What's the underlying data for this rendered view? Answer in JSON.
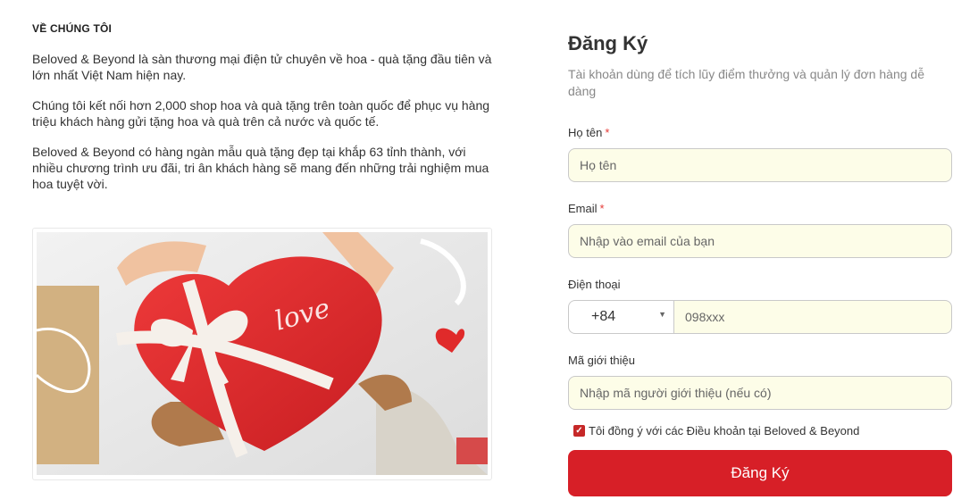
{
  "about": {
    "heading": "VỀ CHÚNG TÔI",
    "paragraphs": [
      "Beloved & Beyond là sàn thương mại điện tử chuyên về hoa - quà tặng đầu tiên và lớn nhất Việt Nam hiện nay.",
      "Chúng tôi kết nối hơn 2,000 shop hoa và quà tặng trên toàn quốc để phục vụ hàng triệu khách hàng gửi tặng hoa và quà trên cả nước và quốc tế.",
      "Beloved & Beyond có hàng ngàn mẫu quà tặng đẹp tại khắp 63 tỉnh thành, với nhiều chương trình ưu đãi, tri ân khách hàng sẽ mang đến những trải nghiệm mua hoa tuyệt vời."
    ],
    "photo_caption_text": "love"
  },
  "signup": {
    "title": "Đăng Ký",
    "subtitle": "Tài khoản dùng để tích lũy điểm thưởng và quản lý đơn hàng dễ dàng",
    "name": {
      "label": "Họ tên",
      "required": "*",
      "placeholder": "Họ tên"
    },
    "email": {
      "label": "Email",
      "required": "*",
      "placeholder": "Nhập vào email của bạn"
    },
    "phone": {
      "label": "Điện thoại",
      "country_code": "+84",
      "placeholder": "098xxx"
    },
    "referral": {
      "label": "Mã giới thiệu",
      "placeholder": "Nhập mã người giới thiệu (nếu có)"
    },
    "agree_text": "Tôi đồng ý với các Điều khoản tại Beloved & Beyond",
    "agree_checked": true,
    "submit_label": "Đăng Ký"
  },
  "colors": {
    "accent": "#d71f27",
    "input_bg": "#fdfde8"
  },
  "icons": {
    "caret": "chevron-down-icon",
    "check": "checkmark-icon"
  }
}
